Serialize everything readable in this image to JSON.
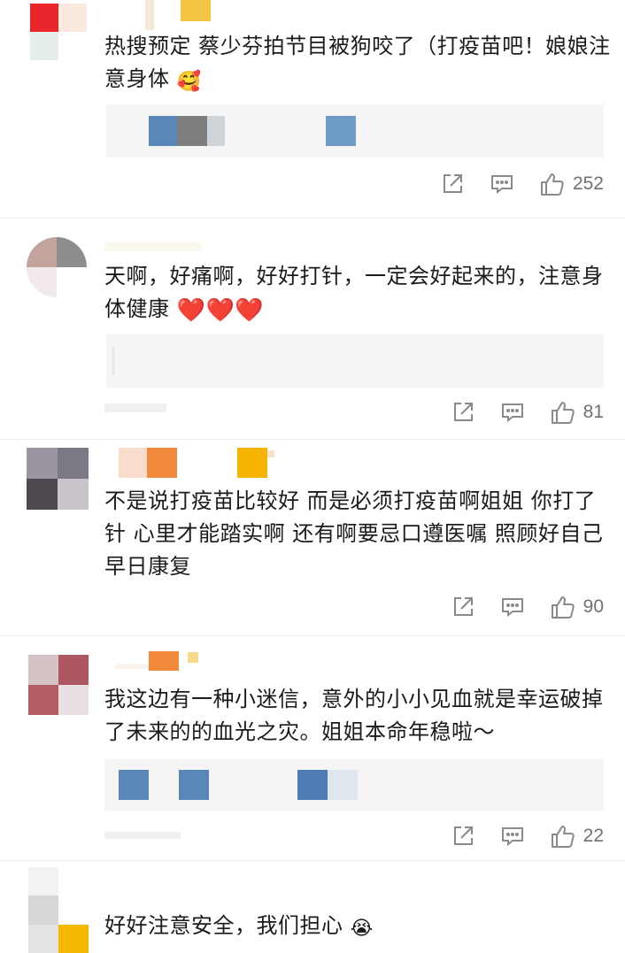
{
  "comments": [
    {
      "text": "热搜预定 蔡少芬拍节目被狗咬了（打疫苗吧！娘娘注意身体",
      "emoji": "🥰",
      "likes": "252"
    },
    {
      "text": "天啊，好痛啊，好好打针，一定会好起来的，注意身体健康",
      "emoji": "❤️❤️❤️",
      "likes": "81"
    },
    {
      "text": "不是说打疫苗比较好 而是必须打疫苗啊姐姐 你打了针 心里才能踏实啊 还有啊要忌口遵医嘱 照顾好自己 早日康复",
      "likes": "90"
    },
    {
      "text": "我这边有一种小迷信，意外的小小见血就是幸运破掉了未来的的血光之灾。姐姐本命年稳啦～",
      "likes": "22"
    },
    {
      "text": "好好注意安全，我们担心",
      "emoji": "😭"
    }
  ],
  "icons": {
    "share": "share-icon",
    "comment": "comment-icon",
    "like": "thumbs-up-icon"
  },
  "colors": {
    "icon_gray": "#8a8a8a",
    "reply_bg": "#f5f5f5",
    "heart_red": "#e0262b"
  }
}
